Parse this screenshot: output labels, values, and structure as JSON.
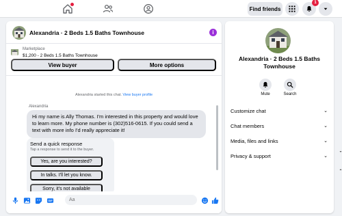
{
  "topbar": {
    "find_friends": "Find friends",
    "notification_count": "1"
  },
  "chat": {
    "title": "Alexandria · 2 Beds 1.5 Baths Townhouse",
    "marketplace_label": "Marketplace",
    "listing_line": "$1,200 - 2 Beds 1.5 Baths Townhouse",
    "view_buyer": "View buyer",
    "more_options": "More options",
    "started_text": "Alexandria started this chat.",
    "started_link": "View buyer profile",
    "sender": "Alexandria",
    "message": "Hi my name is Ally Thomas. I'm interested in this property and would love to learn more. My phone number is (302)516-0615. If you could send a text with more info I'd really appreciate it!",
    "quick_reply": {
      "title": "Send a quick response",
      "subtitle": "Tap a response to send it to the buyer.",
      "options": [
        "Yes, are you interested?",
        "In talks. I'll let you know.",
        "Sorry, it's not available"
      ]
    },
    "composer_placeholder": "Aa"
  },
  "panel": {
    "title": "Alexandria · 2 Beds 1.5 Baths Townhouse",
    "actions": [
      {
        "label": "Mute",
        "icon": "bell-icon"
      },
      {
        "label": "Search",
        "icon": "search-icon"
      }
    ],
    "sections": [
      "Customize chat",
      "Chat members",
      "Media, files and links",
      "Privacy & support"
    ]
  },
  "colors": {
    "accent": "#1877f2",
    "info": "#9b30d9",
    "badge": "#e41e3f"
  }
}
